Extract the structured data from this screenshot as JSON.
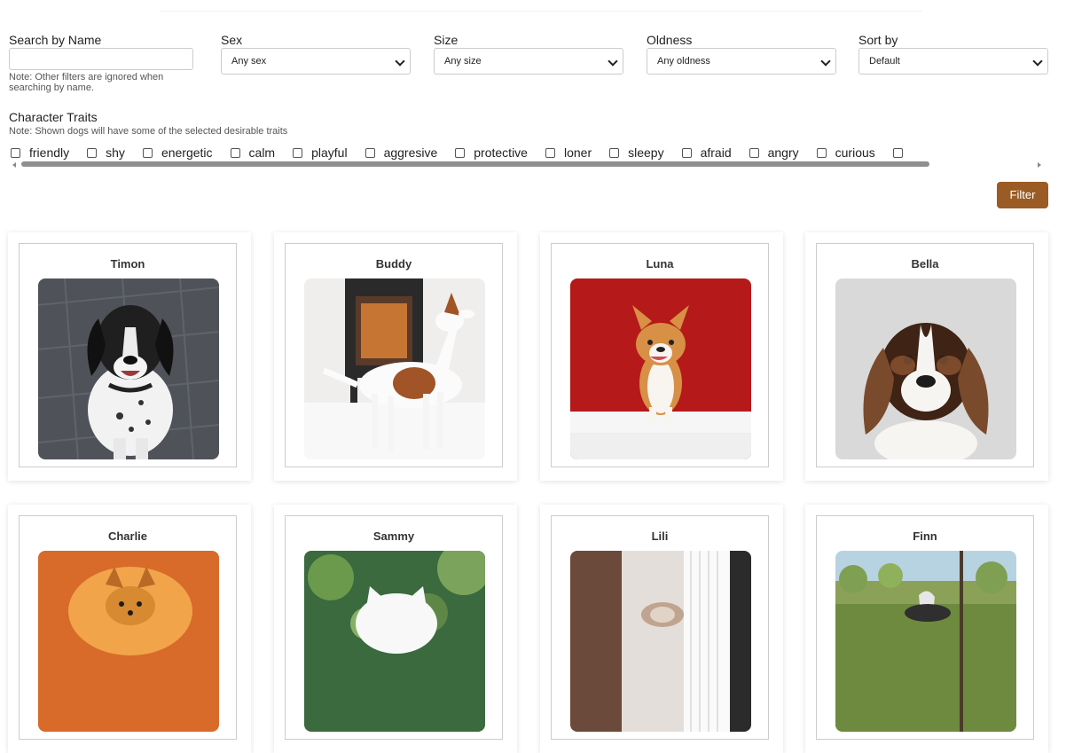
{
  "filters": {
    "name": {
      "label": "Search by Name",
      "value": "",
      "placeholder": "",
      "note": "Note: Other filters are ignored when searching by name."
    },
    "sex": {
      "label": "Sex",
      "selected": "Any sex"
    },
    "size": {
      "label": "Size",
      "selected": "Any size"
    },
    "oldness": {
      "label": "Oldness",
      "selected": "Any oldness"
    },
    "sort": {
      "label": "Sort by",
      "selected": "Default"
    }
  },
  "traits": {
    "title": "Character Traits",
    "note": "Note: Shown dogs will have some of the selected desirable traits",
    "items": [
      "friendly",
      "shy",
      "energetic",
      "calm",
      "playful",
      "aggresive",
      "protective",
      "loner",
      "sleepy",
      "afraid",
      "angry",
      "curious",
      ""
    ]
  },
  "filter_button": {
    "label": "Filter",
    "color": "#9a5c24"
  },
  "dogs": [
    {
      "name": "Timon",
      "photo": "black-and-white-dog-photo"
    },
    {
      "name": "Buddy",
      "photo": "jack-russell-terrier-photo"
    },
    {
      "name": "Luna",
      "photo": "corgi-on-red-photo"
    },
    {
      "name": "Bella",
      "photo": "beagle-puppy-photo"
    },
    {
      "name": "Charlie",
      "photo": "pomeranian-photo"
    },
    {
      "name": "Sammy",
      "photo": "white-dog-in-park-photo"
    },
    {
      "name": "Lili",
      "photo": "small-dog-on-porch-photo"
    },
    {
      "name": "Finn",
      "photo": "dog-in-field-photo"
    }
  ]
}
